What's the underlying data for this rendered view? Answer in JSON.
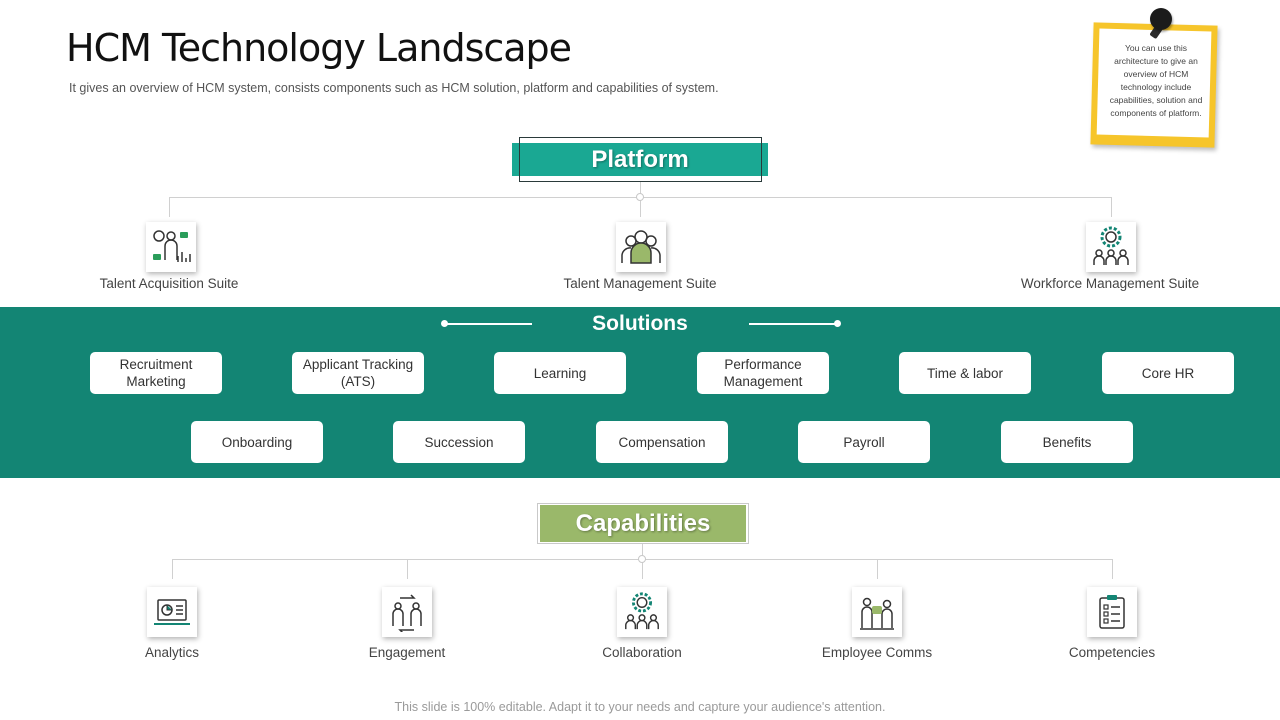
{
  "header": {
    "title": "HCM Technology Landscape",
    "subtitle": "It gives an overview  of HCM system,  consists components such as HCM solution, platform and capabilities of system."
  },
  "note": {
    "text": "You can use this architecture to give an overview of HCM technology include capabilities, solution and components of platform."
  },
  "platform": {
    "title": "Platform",
    "items": [
      {
        "label": "Talent Acquisition Suite",
        "icon": "people-analytics-icon"
      },
      {
        "label": "Talent Management Suite",
        "icon": "team-group-icon"
      },
      {
        "label": "Workforce Management Suite",
        "icon": "gear-people-icon"
      }
    ]
  },
  "solutions": {
    "title": "Solutions",
    "row1": [
      "Recruitment Marketing",
      "Applicant Tracking (ATS)",
      "Learning",
      "Performance Management",
      "Time & labor",
      "Core HR"
    ],
    "row2": [
      "Onboarding",
      "Succession",
      "Compensation",
      "Payroll",
      "Benefits"
    ]
  },
  "capabilities": {
    "title": "Capabilities",
    "items": [
      {
        "label": "Analytics",
        "icon": "laptop-chart-icon"
      },
      {
        "label": "Engagement",
        "icon": "people-exchange-icon"
      },
      {
        "label": "Collaboration",
        "icon": "gear-people-icon"
      },
      {
        "label": "Employee Comms",
        "icon": "people-chat-icon"
      },
      {
        "label": "Competencies",
        "icon": "checklist-icon"
      }
    ]
  },
  "footer": {
    "text": "This slide is 100% editable. Adapt it to your needs and capture your audience's attention."
  },
  "colors": {
    "teal": "#138574",
    "platform_teal": "#1aa893",
    "capabilities_green": "#9ab86a",
    "note_yellow": "#f6c52b"
  }
}
